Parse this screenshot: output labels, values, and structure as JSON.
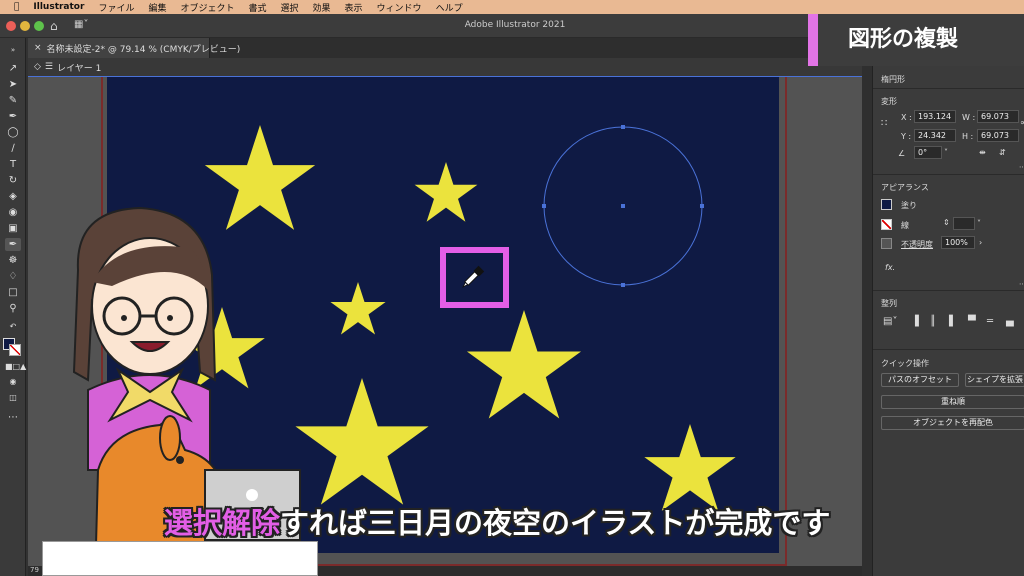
{
  "menubar": {
    "app": "Illustrator",
    "items": [
      "ファイル",
      "編集",
      "オブジェクト",
      "書式",
      "選択",
      "効果",
      "表示",
      "ウィンドウ",
      "ヘルプ"
    ]
  },
  "window": {
    "title": "Adobe Illustrator 2021"
  },
  "document_tab": {
    "label": "名称未設定-2* @ 79.14 % (CMYK/プレビュー)"
  },
  "breadcrumb": {
    "layer": "レイヤー 1"
  },
  "badge": {
    "text": "図形の複製"
  },
  "properties": {
    "object_type": "楕円形",
    "transform_label": "変形",
    "x_label": "X :",
    "x_value": "193.124",
    "y_label": "Y :",
    "y_value": "24.342",
    "w_label": "W :",
    "w_value": "69.073",
    "h_label": "H :",
    "h_value": "69.073",
    "rotate_value": "0°",
    "appearance_label": "アピアランス",
    "fill_label": "塗り",
    "stroke_label": "線",
    "opacity_label": "不透明度",
    "opacity_value": "100%",
    "fx_label": "fx.",
    "align_label": "整列",
    "quick_actions_label": "クイック操作",
    "offset_path_button": "パスのオフセット",
    "expand_shape_button": "シェイプを拡張",
    "arrange_button": "重ね順",
    "recolor_button": "オブジェクトを再配色"
  },
  "subtitle": {
    "highlight": "選択解除",
    "rest": "すれば三日月の夜空のイラストが完成です"
  },
  "status": {
    "zoom": "79"
  },
  "colors": {
    "artboard": "#0f1a44",
    "star": "#ebe33d",
    "highlight": "#e35ee6",
    "menubar": "#e9b993"
  }
}
